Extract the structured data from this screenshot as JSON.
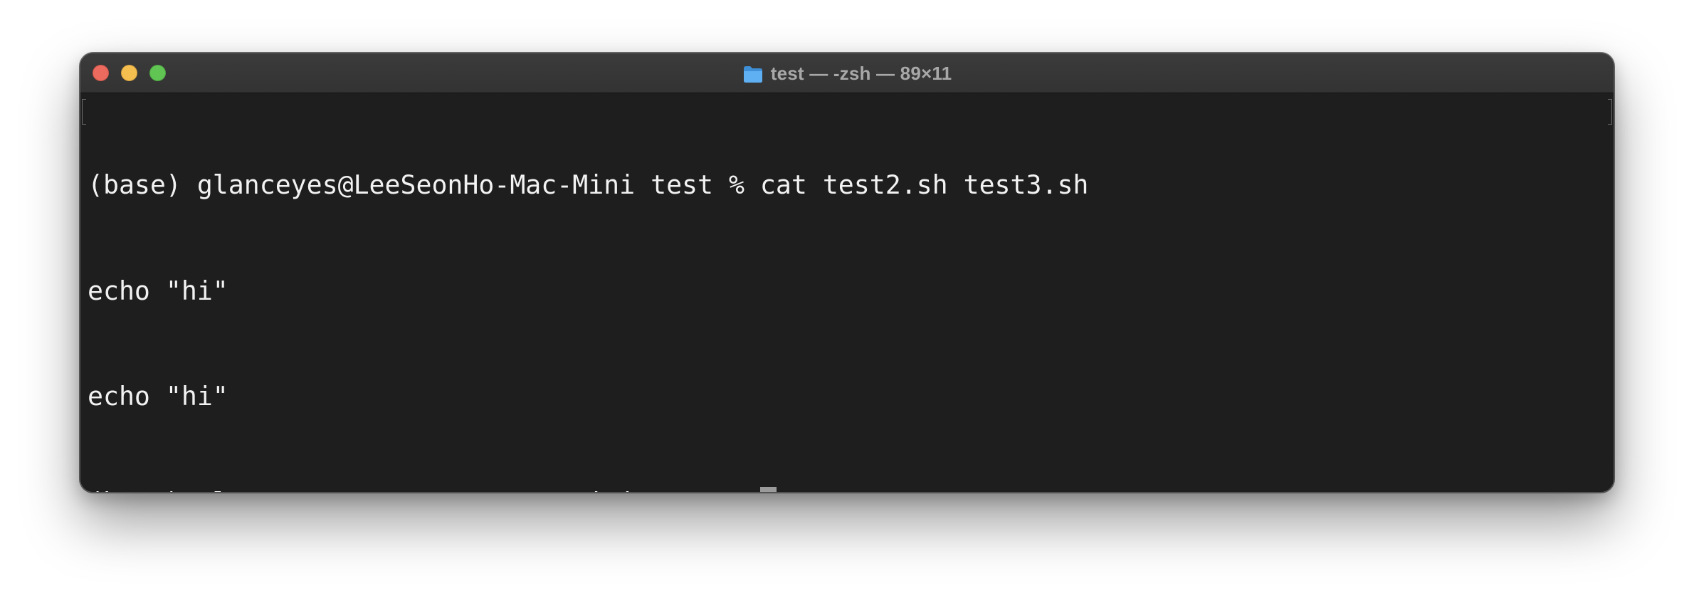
{
  "window": {
    "title": "test — -zsh — 89×11",
    "title_icon": "folder-icon"
  },
  "colors": {
    "terminal_bg": "#1e1e1e",
    "text": "#f2f2f2",
    "cursor": "#9b9b9b",
    "close": "#ed6a5e",
    "minimize": "#f5bf4f",
    "maximize": "#61c554"
  },
  "terminal": {
    "lines": [
      "(base) glanceyes@LeeSeonHo-Mac-Mini test % cat test2.sh test3.sh",
      "echo \"hi\"",
      "echo \"hi\""
    ],
    "prompt": "(base) glanceyes@LeeSeonHo-Mac-Mini test %"
  }
}
